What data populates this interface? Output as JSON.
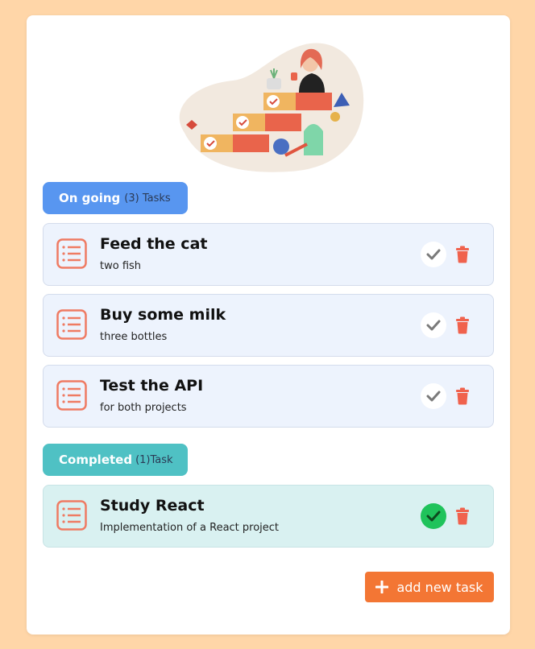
{
  "ongoing": {
    "title": "On going",
    "count": "(3) Tasks",
    "tasks": [
      {
        "title": "Feed the cat",
        "description": "two fish"
      },
      {
        "title": "Buy some milk",
        "description": "three bottles"
      },
      {
        "title": "Test the API",
        "description": "for both projects"
      }
    ]
  },
  "completed": {
    "title": "Completed",
    "count": "(1)Task",
    "tasks": [
      {
        "title": "Study React",
        "description": "Implementation of a React project"
      }
    ]
  },
  "add_button": {
    "label": "add new task",
    "icon": "plus-icon"
  },
  "colors": {
    "background": "#ffd6a8",
    "ongoing_pill": "#5896f0",
    "completed_pill": "#4fc1c4",
    "accent": "#f37634",
    "delete": "#f0624d",
    "check_done": "#1fc35b"
  }
}
